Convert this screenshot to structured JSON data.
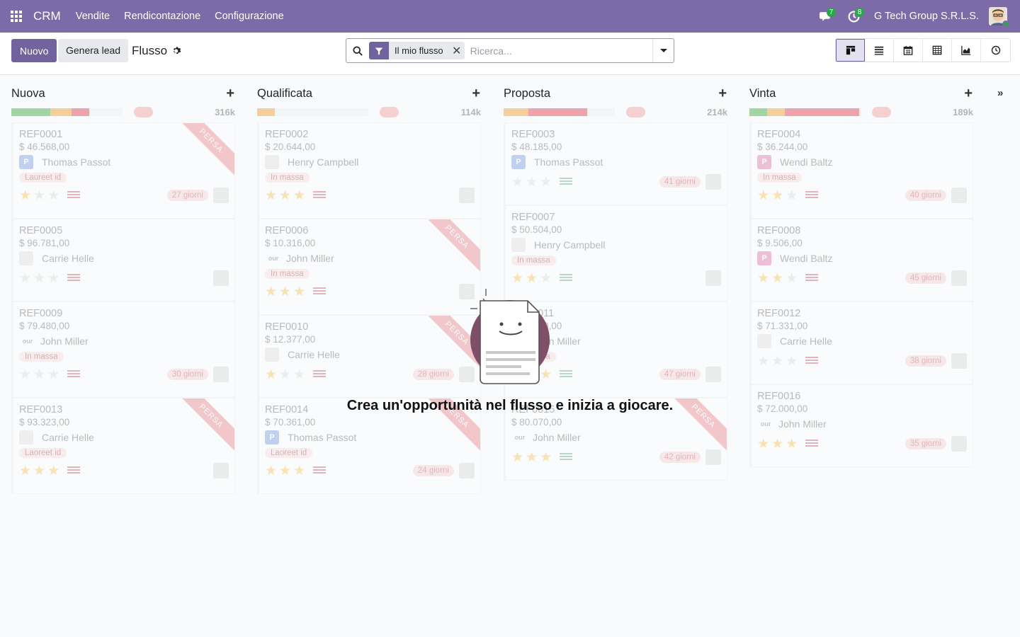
{
  "navbar": {
    "brand": "CRM",
    "menu": [
      "Vendite",
      "Rendicontazione",
      "Configurazione"
    ],
    "messages_count": "7",
    "activities_count": "8",
    "company": "G Tech Group S.R.L.S."
  },
  "control_panel": {
    "new_button": "Nuovo",
    "generate_lead_button": "Genera lead",
    "breadcrumb": "Flusso",
    "search": {
      "facet_value": "Il mio flusso",
      "placeholder": "Ricerca..."
    },
    "views": [
      "kanban",
      "list",
      "calendar",
      "pivot",
      "graph",
      "activity"
    ]
  },
  "kanban": {
    "columns": [
      {
        "title": "Nuova",
        "total": "316k",
        "cards": [
          {
            "ref": "REF0001",
            "amount": "$ 46.568,00",
            "person": "Thomas Passot",
            "avatar": "P",
            "avatar_type": "blue",
            "tag": "Laureet id",
            "stars": 1,
            "days": "27 giorni",
            "lost": true
          },
          {
            "ref": "REF0005",
            "amount": "$ 96.781,00",
            "person": "Carrie Helle",
            "avatar": "",
            "avatar_type": "img",
            "tag": "",
            "stars": 0,
            "days": "",
            "lost": false
          },
          {
            "ref": "REF0009",
            "amount": "$ 79.480,00",
            "person": "John Miller",
            "avatar": "our",
            "avatar_type": "text",
            "tag": "In massa",
            "stars": 0,
            "days": "30 giorni",
            "lost": false
          },
          {
            "ref": "REF0013",
            "amount": "$ 93.323,00",
            "person": "Carrie Helle",
            "avatar": "",
            "avatar_type": "img",
            "tag": "Laoreet id",
            "stars": 3,
            "days": "",
            "lost": true
          }
        ]
      },
      {
        "title": "Qualificata",
        "total": "114k",
        "cards": [
          {
            "ref": "REF0002",
            "amount": "$ 20.644,00",
            "person": "Henry Campbell",
            "avatar": "",
            "avatar_type": "img",
            "tag": "In massa",
            "stars": 3,
            "days": "",
            "lost": false
          },
          {
            "ref": "REF0006",
            "amount": "$ 10.316,00",
            "person": "John Miller",
            "avatar": "our",
            "avatar_type": "text",
            "tag": "In massa",
            "stars": 3,
            "days": "",
            "lost": true
          },
          {
            "ref": "REF0010",
            "amount": "$ 12.377,00",
            "person": "Carrie Helle",
            "avatar": "",
            "avatar_type": "img",
            "tag": "",
            "stars": 1,
            "days": "28 giorni",
            "lost": true
          },
          {
            "ref": "REF0014",
            "amount": "$ 70.361,00",
            "person": "Thomas Passot",
            "avatar": "P",
            "avatar_type": "blue",
            "tag": "Laoreet id",
            "stars": 3,
            "days": "24 giorni",
            "lost": true
          }
        ]
      },
      {
        "title": "Proposta",
        "total": "214k",
        "cards": [
          {
            "ref": "REF0003",
            "amount": "$ 48.185,00",
            "person": "Thomas Passot",
            "avatar": "P",
            "avatar_type": "blue",
            "tag": "",
            "stars": 0,
            "days": "41 giorni",
            "lost": false
          },
          {
            "ref": "REF0007",
            "amount": "$ 50.504,00",
            "person": "Henry Campbell",
            "avatar": "",
            "avatar_type": "img",
            "tag": "In massa",
            "stars": 2,
            "days": "",
            "lost": false
          },
          {
            "ref": "REF0011",
            "amount": "$ 35.000,00",
            "person": "John Miller",
            "avatar": "our",
            "avatar_type": "text",
            "tag": "In massa",
            "stars": 3,
            "days": "47 giorni",
            "lost": false
          },
          {
            "ref": "REF0015",
            "amount": "$ 80.070,00",
            "person": "John Miller",
            "avatar": "our",
            "avatar_type": "text",
            "tag": "",
            "stars": 3,
            "days": "42 giorni",
            "lost": true
          }
        ]
      },
      {
        "title": "Vinta",
        "total": "189k",
        "cards": [
          {
            "ref": "REF0004",
            "amount": "$ 36.244,00",
            "person": "Wendi Baltz",
            "avatar": "P",
            "avatar_type": "pink",
            "tag": "In massa",
            "stars": 2,
            "days": "40 giorni",
            "lost": false
          },
          {
            "ref": "REF0008",
            "amount": "$ 9.506,00",
            "person": "Wendi Baltz",
            "avatar": "P",
            "avatar_type": "pink",
            "tag": "",
            "stars": 2,
            "days": "45 giorni",
            "lost": false
          },
          {
            "ref": "REF0012",
            "amount": "$ 71.331,00",
            "person": "Carrie Helle",
            "avatar": "",
            "avatar_type": "img",
            "tag": "",
            "stars": 0,
            "days": "38 giorni",
            "lost": false
          },
          {
            "ref": "REF0016",
            "amount": "$ 72.000,00",
            "person": "John Miller",
            "avatar": "our",
            "avatar_type": "text",
            "tag": "",
            "stars": 3,
            "days": "35 giorni",
            "lost": false
          }
        ]
      }
    ],
    "lost_ribbon": "PERSA"
  },
  "helper": {
    "text": "Crea un'opportunità nel flusso e inizia a giocare."
  },
  "colors": {
    "navbar": "#7c6ba6",
    "primary": "#71639e",
    "badge": "#28a745"
  }
}
